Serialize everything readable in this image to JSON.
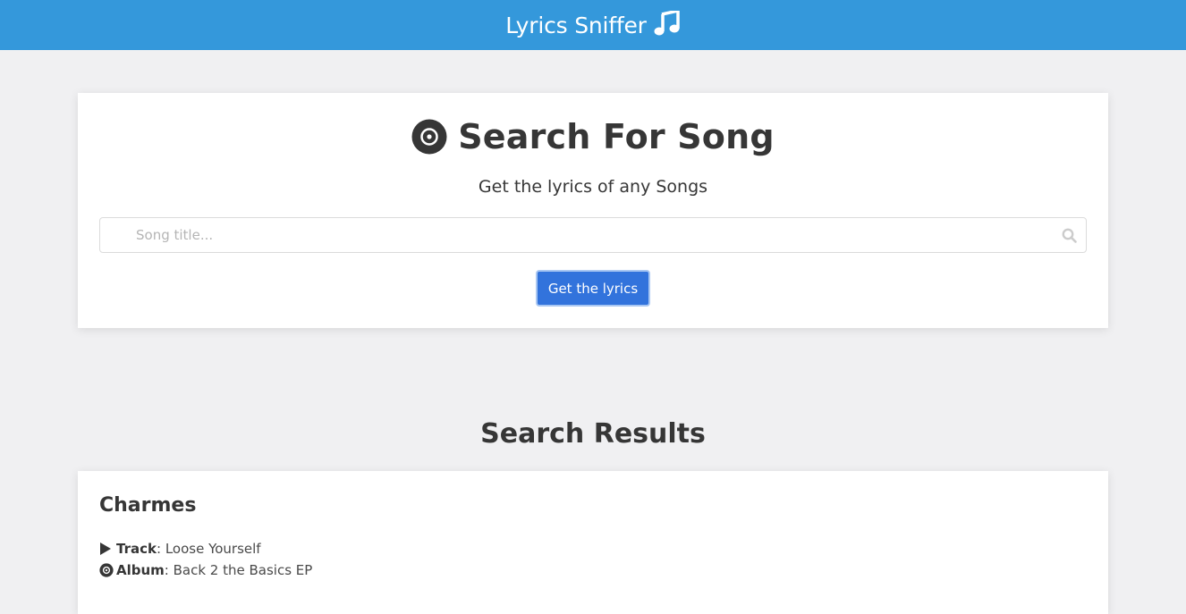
{
  "header": {
    "title": "Lyrics Sniffer",
    "icon": "music-note-icon"
  },
  "search": {
    "title": "Search For Song",
    "subtitle": "Get the lyrics of any Songs",
    "placeholder": "Song title...",
    "value": "",
    "button_label": "Get the lyrics"
  },
  "results": {
    "heading": "Search Results",
    "items": [
      {
        "artist": "Charmes",
        "track_label": "Track",
        "track": "Loose Yourself",
        "album_label": "Album",
        "album": "Back 2 the Basics EP"
      }
    ]
  },
  "colors": {
    "navbar": "#3498db",
    "page_bg": "#f0f0f2",
    "button": "#3273dc",
    "text": "#363636"
  }
}
